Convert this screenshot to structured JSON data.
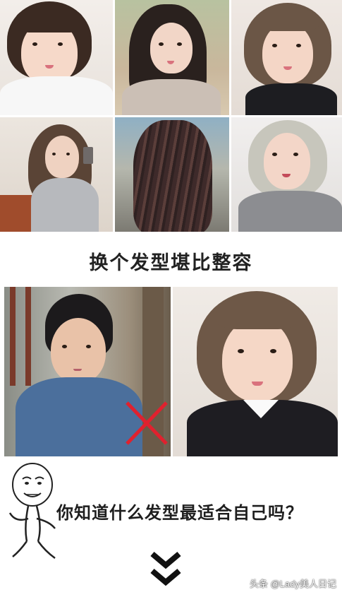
{
  "headline": "换个发型堪比整容",
  "question": "你知道什么发型最适合自己吗？",
  "watermark": "头条 @Lady美人日记",
  "colors": {
    "headline": "#222222",
    "question": "#1e1e1e",
    "cross": "#e0212e"
  }
}
